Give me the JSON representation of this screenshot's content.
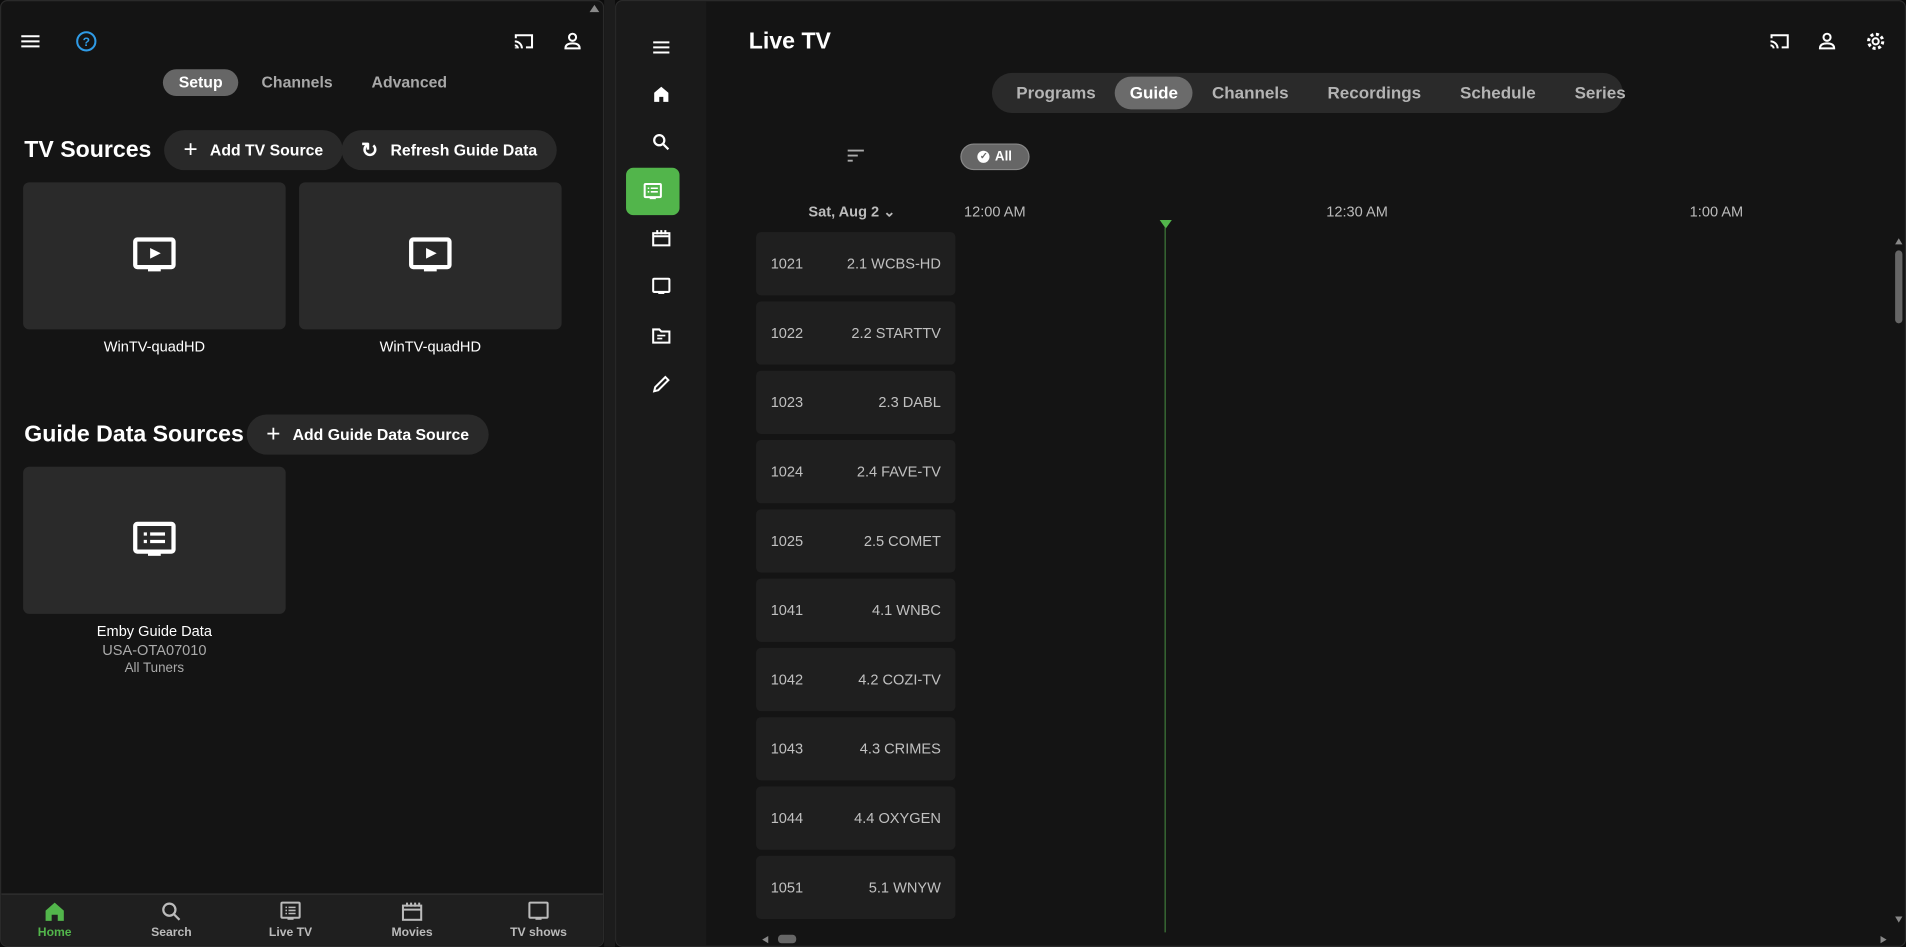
{
  "left_panel": {
    "tabs": [
      "Setup",
      "Channels",
      "Advanced"
    ],
    "active_tab": "Setup",
    "tv_sources": {
      "heading": "TV Sources",
      "add_button": "Add TV Source",
      "refresh_button": "Refresh Guide Data",
      "cards": [
        {
          "label": "WinTV-quadHD"
        },
        {
          "label": "WinTV-quadHD"
        }
      ]
    },
    "guide_sources": {
      "heading": "Guide Data Sources",
      "add_button": "Add Guide Data Source",
      "cards": [
        {
          "label": "Emby Guide Data",
          "line2": "USA-OTA07010",
          "line3": "All Tuners"
        }
      ]
    },
    "bottom_nav": [
      {
        "label": "Home",
        "icon": "home-icon",
        "active": true
      },
      {
        "label": "Search",
        "icon": "search-icon"
      },
      {
        "label": "Live TV",
        "icon": "live-tv-icon"
      },
      {
        "label": "Movies",
        "icon": "movies-icon"
      },
      {
        "label": "TV shows",
        "icon": "tv-icon"
      }
    ]
  },
  "right_panel": {
    "title": "Live TV",
    "tabs": [
      "Programs",
      "Guide",
      "Channels",
      "Recordings",
      "Schedule",
      "Series"
    ],
    "active_tab": "Guide",
    "filter_chip": "All",
    "date": "Sat, Aug 2",
    "times": [
      "12:00 AM",
      "12:30 AM",
      "1:00 AM"
    ],
    "channels": [
      {
        "number": "1021",
        "name": "2.1 WCBS-HD"
      },
      {
        "number": "1022",
        "name": "2.2 STARTTV"
      },
      {
        "number": "1023",
        "name": "2.3 DABL"
      },
      {
        "number": "1024",
        "name": "2.4 FAVE-TV"
      },
      {
        "number": "1025",
        "name": "2.5 COMET"
      },
      {
        "number": "1041",
        "name": "4.1 WNBC"
      },
      {
        "number": "1042",
        "name": "4.2 COZI-TV"
      },
      {
        "number": "1043",
        "name": "4.3 CRIMES"
      },
      {
        "number": "1044",
        "name": "4.4 OXYGEN"
      },
      {
        "number": "1051",
        "name": "5.1 WNYW"
      }
    ]
  },
  "colors": {
    "accent": "#52b54b",
    "help": "#2f9be6",
    "panel": "#141414",
    "card": "#2a2a2a"
  }
}
